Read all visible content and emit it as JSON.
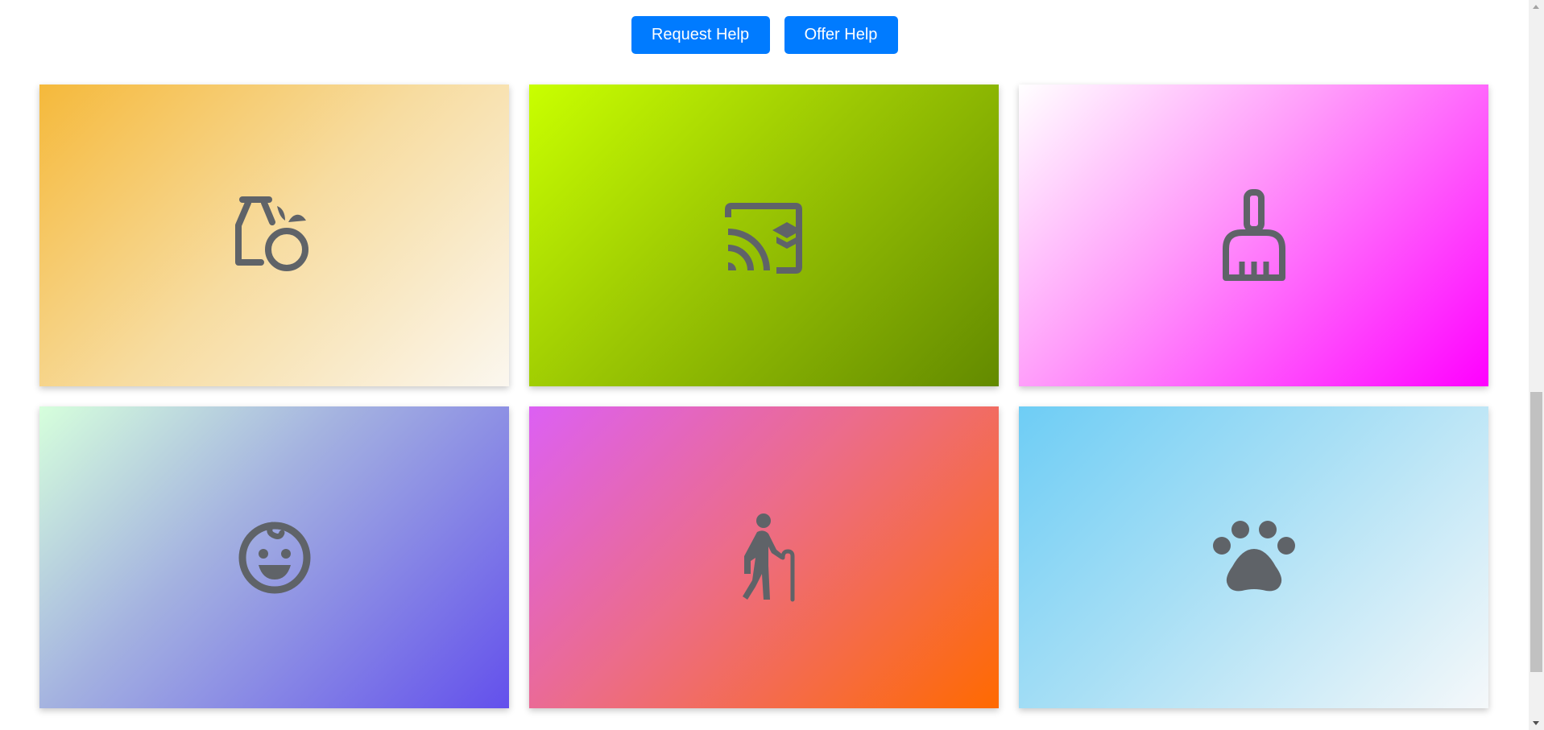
{
  "actions": {
    "request_label": "Request Help",
    "offer_label": "Offer Help"
  },
  "cards": [
    {
      "icon": "grocery-icon"
    },
    {
      "icon": "cast-for-education-icon"
    },
    {
      "icon": "cleaning-brush-icon"
    },
    {
      "icon": "child-care-icon"
    },
    {
      "icon": "elderly-icon"
    },
    {
      "icon": "pets-icon"
    }
  ],
  "colors": {
    "button": "#007bff",
    "icon": "#5f6368"
  }
}
